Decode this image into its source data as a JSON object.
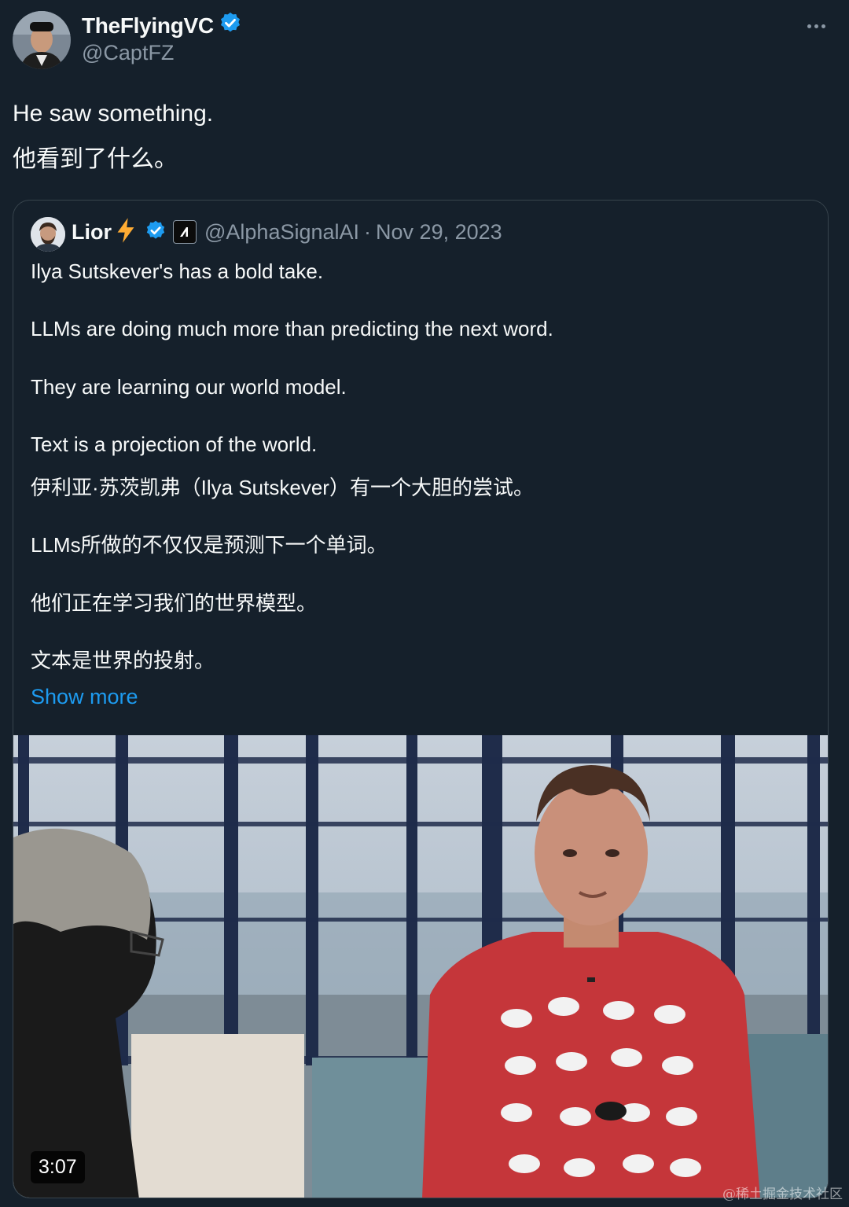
{
  "author": {
    "display_name": "TheFlyingVC",
    "handle": "@CaptFZ",
    "verified": true,
    "avatar": "avatar-photo"
  },
  "tweet": {
    "lines": [
      "He saw something.",
      "他看到了什么。"
    ]
  },
  "menu_icon": "more-dots-icon",
  "quote": {
    "name": "Lior",
    "emoji": "lightning-bolt",
    "verified": true,
    "affiliate_badge": "alphasignal-logo",
    "handle": "@AlphaSignalAI",
    "separator": "·",
    "date": "Nov 29, 2023",
    "lines": [
      "Ilya Sutskever's has a bold take.",
      "LLMs are doing much more than predicting the next word.",
      "They are learning our world model.",
      "Text is a projection of the world.",
      "伊利亚·苏茨凯弗（Ilya Sutskever）有一个大胆的尝试。",
      "LLMs所做的不仅仅是预测下一个单词。",
      "他们正在学习我们的世界模型。",
      "文本是世界的投射。"
    ],
    "show_more": "Show more"
  },
  "video": {
    "duration": "3:07"
  },
  "watermark": "@稀土掘金技术社区",
  "colors": {
    "background": "#15202b",
    "text": "#f7f9f9",
    "muted": "#8b98a5",
    "link": "#1d9bf0",
    "verified": "#1d9bf0",
    "border": "#38444d"
  }
}
